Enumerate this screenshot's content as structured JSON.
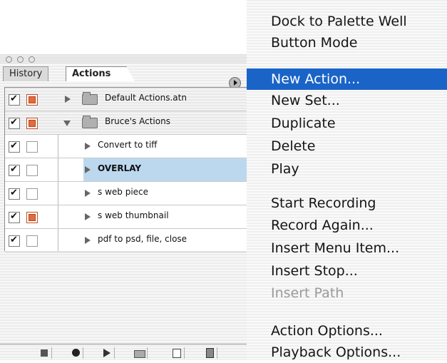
{
  "palette": {
    "tabs": [
      "History",
      "Actions"
    ],
    "rows": [
      {
        "label": "Default Actions.atn",
        "type": "set",
        "expanded": false,
        "checked": true,
        "dialog": true
      },
      {
        "label": "Bruce's Actions",
        "type": "set",
        "expanded": true,
        "checked": true,
        "dialog": true
      },
      {
        "label": "Convert to tiff",
        "type": "action",
        "checked": true,
        "dialog": false
      },
      {
        "label": "OVERLAY",
        "type": "action",
        "checked": true,
        "dialog": false,
        "selected": true
      },
      {
        "label": "s web piece",
        "type": "action",
        "checked": true,
        "dialog": false
      },
      {
        "label": "s web thumbnail",
        "type": "action",
        "checked": true,
        "dialog": true
      },
      {
        "label": "pdf to psd, file, close",
        "type": "action",
        "checked": true,
        "dialog": false
      }
    ],
    "bottom_buttons": [
      "stop-icon",
      "record-icon",
      "play-icon",
      "new-set-icon",
      "new-action-icon",
      "trash-icon"
    ]
  },
  "menu": {
    "items": [
      {
        "label": "Dock to Palette Well"
      },
      {
        "label": "Button Mode"
      },
      {
        "label": "New Action...",
        "highlighted": true
      },
      {
        "label": "New Set..."
      },
      {
        "label": "Duplicate"
      },
      {
        "label": "Delete"
      },
      {
        "label": "Play"
      },
      {
        "label": "Start Recording"
      },
      {
        "label": "Record Again..."
      },
      {
        "label": "Insert Menu Item..."
      },
      {
        "label": "Insert Stop..."
      },
      {
        "label": "Insert Path",
        "disabled": true
      },
      {
        "label": "Action Options..."
      },
      {
        "label": "Playback Options..."
      }
    ]
  },
  "colors": {
    "highlight": "#1a64c8",
    "selection": "#bcd8ef",
    "dialog_on": "#e66a3a"
  }
}
